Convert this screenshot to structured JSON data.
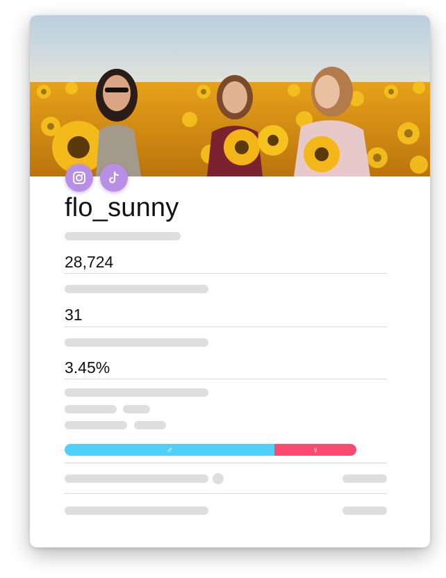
{
  "profile": {
    "username": "flo_sunny",
    "followers": "28,724",
    "posts": "31",
    "engagement": "3.45%"
  },
  "social_icons": [
    "instagram-icon",
    "tiktok-icon"
  ],
  "gender_split": {
    "male_fraction": 0.72,
    "female_fraction": 0.28,
    "male_symbol": "♂",
    "female_symbol": "♀",
    "male_color": "#4fd0fb",
    "female_color": "#fb4a71"
  },
  "colors": {
    "social_icon_bg": "#b88ee6",
    "placeholder": "#dedede",
    "divider": "#d8d8d8"
  }
}
